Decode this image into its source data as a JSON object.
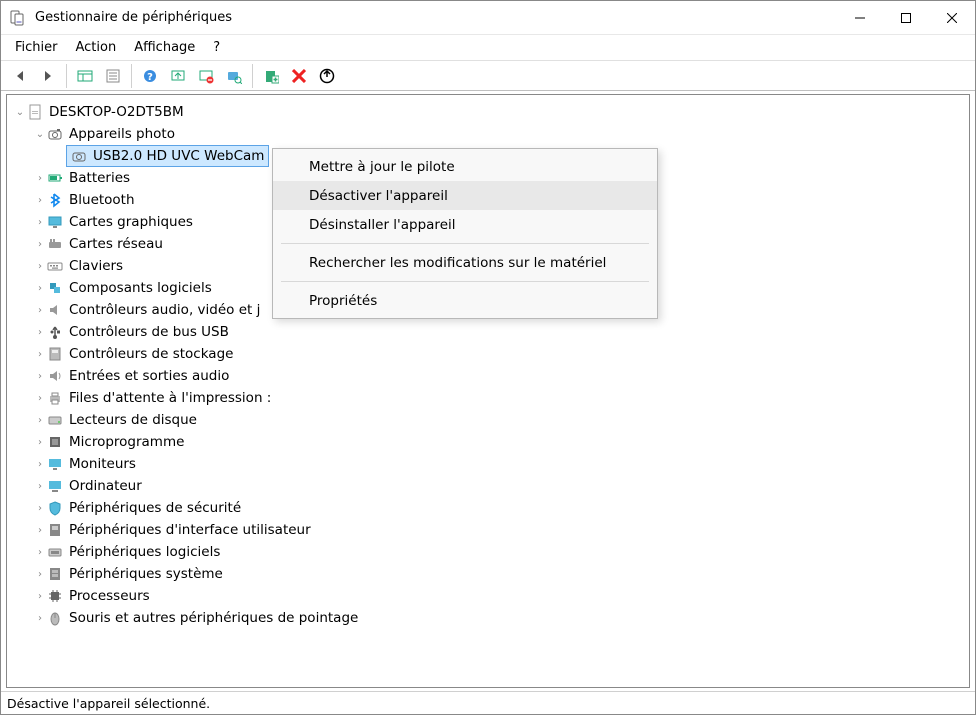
{
  "title": "Gestionnaire de périphériques",
  "menu": {
    "file": "Fichier",
    "action": "Action",
    "view": "Affichage",
    "help": "?"
  },
  "toolbar_icons": [
    "back",
    "forward",
    "show-hide",
    "properties",
    "help",
    "update",
    "uninstall",
    "scan",
    "monitors",
    "add",
    "remove",
    "legacy"
  ],
  "root": {
    "name": "DESKTOP-O2DT5BM"
  },
  "selected_device": "USB2.0 HD UVC WebCam",
  "categories": {
    "cameras": "Appareils photo",
    "batteries": "Batteries",
    "bluetooth": "Bluetooth",
    "display": "Cartes graphiques",
    "network": "Cartes réseau",
    "keyboards": "Claviers",
    "software_components": "Composants logiciels",
    "sound_video": "Contrôleurs audio, vidéo et j",
    "usb": "Contrôleurs de bus USB",
    "storage": "Contrôleurs de stockage",
    "audio_io": "Entrées et sorties audio",
    "print_queues": "Files d'attente à l'impression :",
    "disk_drives": "Lecteurs de disque",
    "firmware": "Microprogramme",
    "monitors": "Moniteurs",
    "computer": "Ordinateur",
    "security": "Périphériques de sécurité",
    "hid": "Périphériques d'interface utilisateur",
    "software_devices": "Périphériques logiciels",
    "system": "Périphériques système",
    "processors": "Processeurs",
    "mice": "Souris et autres périphériques de pointage"
  },
  "context_menu": {
    "update": "Mettre à jour le pilote",
    "disable": "Désactiver l'appareil",
    "uninstall": "Désinstaller l'appareil",
    "scan": "Rechercher les modifications sur le matériel",
    "properties": "Propriétés"
  },
  "status": "Désactive l'appareil sélectionné."
}
